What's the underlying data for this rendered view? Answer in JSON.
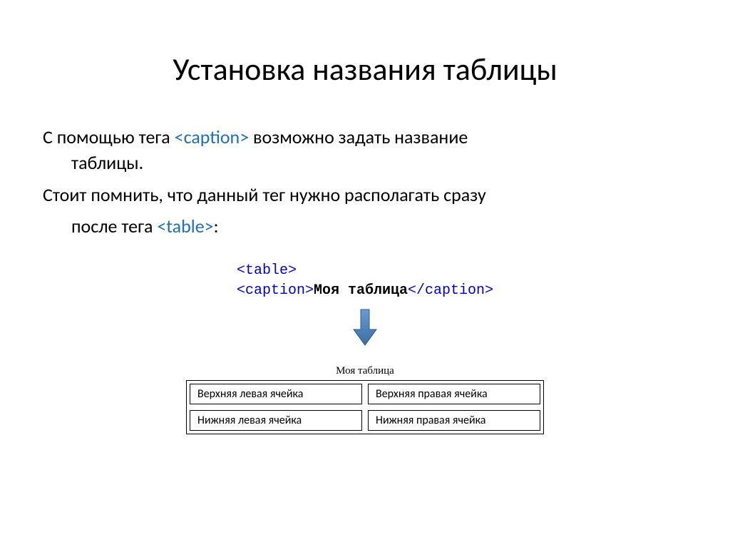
{
  "title": "Установка названия таблицы",
  "paragraph1": {
    "pre": "С помощью тега ",
    "tag": "<caption>",
    "post": "  возможно задать название",
    "line2": "таблицы."
  },
  "paragraph2": {
    "line1": "Стоит помнить, что данный тег нужно располагать сразу",
    "line2_pre": "после тега ",
    "line2_tag": "<table>",
    "line2_post": ":"
  },
  "code": {
    "line1": "<table>",
    "line2_open": "<caption>",
    "line2_text": "Моя таблица",
    "line2_close": "</caption>"
  },
  "demo": {
    "caption": "Моя таблица",
    "cells": {
      "tl": "Верхняя левая ячейка",
      "tr": "Верхняя правая ячейка",
      "bl": "Нижняя левая ячейка",
      "br": "Нижняя правая ячейка"
    }
  }
}
